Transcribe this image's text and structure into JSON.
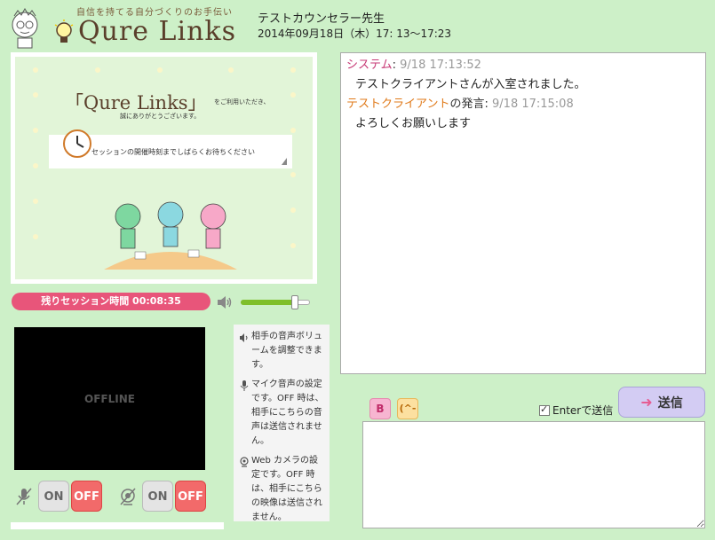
{
  "header": {
    "tagline": "自信を持てる自分づくりのお手伝い",
    "logo": "Qure Links",
    "counselor": "テストカウンセラー先生",
    "datetime": "2014年09月18日（木）17: 13〜17:23"
  },
  "waiting": {
    "title": "「Qure Links」",
    "title_suffix": "をご利用いただき、",
    "thanks": "誠にありがとうございます。",
    "notice": "セッションの開催時刻までしばらくお待ちください"
  },
  "session": {
    "timer": "残りセッション時間 00:08:35",
    "volume_level": 0.78
  },
  "video": {
    "status": "OFFLINE"
  },
  "controls": {
    "mic_on": "ON",
    "mic_off": "OFF",
    "cam_on": "ON",
    "cam_off": "OFF"
  },
  "help": {
    "volume": "相手の音声ボリュームを調整できます。",
    "mic": "マイク音声の設定です。OFF 時は、相手にこちらの音声は送信されません。",
    "camera": "Web カメラの設定です。OFF 時は、相手にこちらの映像は送信されません。"
  },
  "chat": {
    "messages": [
      {
        "sender": "システム",
        "suffix": ":",
        "time": "9/18 17:13:52",
        "text": "テストクライアントさんが入室されました。"
      },
      {
        "sender": "テストクライアント",
        "suffix": "の発言:",
        "time": "9/18 17:15:08",
        "text": "よろしくお願いします"
      }
    ]
  },
  "composer": {
    "bold_label": "B",
    "emoji_label": "(^-^)",
    "enter_label": "Enterで送信",
    "send_label": "送信"
  },
  "colors": {
    "background": "#cdf0c8",
    "timer": "#e8557a",
    "system_sender": "#c73a76",
    "client_sender": "#e07a1a",
    "off_button": "#f26a6a"
  }
}
